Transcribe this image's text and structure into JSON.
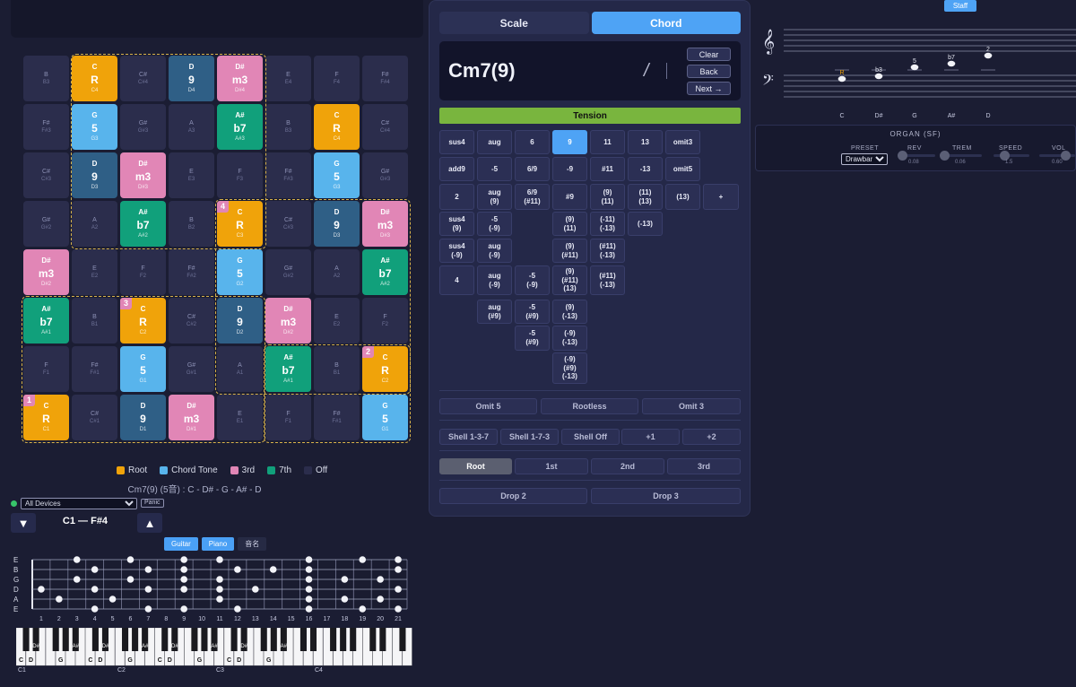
{
  "pads": [
    [
      {
        "n": "B",
        "o": "B3"
      },
      {
        "n": "C",
        "o": "C4",
        "i": "R",
        "t": "root"
      },
      {
        "n": "C#",
        "o": "C#4"
      },
      {
        "n": "D",
        "o": "D4",
        "i": "9",
        "t": "tone-9"
      },
      {
        "n": "D#",
        "o": "D#4",
        "i": "m3",
        "t": "third"
      },
      {
        "n": "E",
        "o": "E4"
      },
      {
        "n": "F",
        "o": "F4"
      },
      {
        "n": "F#",
        "o": "F#4"
      }
    ],
    [
      {
        "n": "F#",
        "o": "F#3"
      },
      {
        "n": "G",
        "o": "G3",
        "i": "5",
        "t": "tone-5"
      },
      {
        "n": "G#",
        "o": "G#3"
      },
      {
        "n": "A",
        "o": "A3"
      },
      {
        "n": "A#",
        "o": "A#3",
        "i": "b7",
        "t": "seventh"
      },
      {
        "n": "B",
        "o": "B3"
      },
      {
        "n": "C",
        "o": "C4",
        "i": "R",
        "t": "root"
      },
      {
        "n": "C#",
        "o": "C#4"
      }
    ],
    [
      {
        "n": "C#",
        "o": "C#3"
      },
      {
        "n": "D",
        "o": "D3",
        "i": "9",
        "t": "tone-9"
      },
      {
        "n": "D#",
        "o": "D#3",
        "i": "m3",
        "t": "third"
      },
      {
        "n": "E",
        "o": "E3"
      },
      {
        "n": "F",
        "o": "F3"
      },
      {
        "n": "F#",
        "o": "F#3"
      },
      {
        "n": "G",
        "o": "G3",
        "i": "5",
        "t": "tone-5"
      },
      {
        "n": "G#",
        "o": "G#3"
      }
    ],
    [
      {
        "n": "G#",
        "o": "G#2"
      },
      {
        "n": "A",
        "o": "A2"
      },
      {
        "n": "A#",
        "o": "A#2",
        "i": "b7",
        "t": "seventh"
      },
      {
        "n": "B",
        "o": "B2"
      },
      {
        "n": "C",
        "o": "C3",
        "i": "R",
        "t": "root",
        "b": "4"
      },
      {
        "n": "C#",
        "o": "C#3"
      },
      {
        "n": "D",
        "o": "D3",
        "i": "9",
        "t": "tone-9"
      },
      {
        "n": "D#",
        "o": "D#3",
        "i": "m3",
        "t": "third"
      }
    ],
    [
      {
        "n": "D#",
        "o": "D#2",
        "i": "m3",
        "t": "third"
      },
      {
        "n": "E",
        "o": "E2"
      },
      {
        "n": "F",
        "o": "F2"
      },
      {
        "n": "F#",
        "o": "F#2"
      },
      {
        "n": "G",
        "o": "G2",
        "i": "5",
        "t": "tone-5"
      },
      {
        "n": "G#",
        "o": "G#2"
      },
      {
        "n": "A",
        "o": "A2"
      },
      {
        "n": "A#",
        "o": "A#2",
        "i": "b7",
        "t": "seventh"
      }
    ],
    [
      {
        "n": "A#",
        "o": "A#1",
        "i": "b7",
        "t": "seventh"
      },
      {
        "n": "B",
        "o": "B1"
      },
      {
        "n": "C",
        "o": "C2",
        "i": "R",
        "t": "root",
        "b": "3"
      },
      {
        "n": "C#",
        "o": "C#2"
      },
      {
        "n": "D",
        "o": "D2",
        "i": "9",
        "t": "tone-9"
      },
      {
        "n": "D#",
        "o": "D#2",
        "i": "m3",
        "t": "third"
      },
      {
        "n": "E",
        "o": "E2"
      },
      {
        "n": "F",
        "o": "F2"
      }
    ],
    [
      {
        "n": "F",
        "o": "F1"
      },
      {
        "n": "F#",
        "o": "F#1"
      },
      {
        "n": "G",
        "o": "G1",
        "i": "5",
        "t": "tone-5"
      },
      {
        "n": "G#",
        "o": "G#1"
      },
      {
        "n": "A",
        "o": "A1"
      },
      {
        "n": "A#",
        "o": "A#1",
        "i": "b7",
        "t": "seventh"
      },
      {
        "n": "B",
        "o": "B1"
      },
      {
        "n": "C",
        "o": "C2",
        "i": "R",
        "t": "root",
        "b": "2"
      }
    ],
    [
      {
        "n": "C",
        "o": "C1",
        "i": "R",
        "t": "root",
        "b": "1"
      },
      {
        "n": "C#",
        "o": "C#1"
      },
      {
        "n": "D",
        "o": "D1",
        "i": "9",
        "t": "tone-9"
      },
      {
        "n": "D#",
        "o": "D#1",
        "i": "m3",
        "t": "third"
      },
      {
        "n": "E",
        "o": "E1"
      },
      {
        "n": "F",
        "o": "F1"
      },
      {
        "n": "F#",
        "o": "F#1"
      },
      {
        "n": "G",
        "o": "G1",
        "i": "5",
        "t": "tone-5"
      }
    ]
  ],
  "legend": [
    {
      "label": "Root",
      "color": "#f0a30a"
    },
    {
      "label": "Chord Tone",
      "color": "#58b4ec"
    },
    {
      "label": "3rd",
      "color": "#e186b6"
    },
    {
      "label": "7th",
      "color": "#11a07b"
    },
    {
      "label": "Off",
      "color": "#2b2d4c"
    }
  ],
  "chord_formula": "Cm7(9) (5音) : C - D# - G - A# - D",
  "device": {
    "selected": "All Devices",
    "panic": "Panic"
  },
  "octave": {
    "down": "▼",
    "up": "▲",
    "range": "C1 — F#4"
  },
  "instrument_tabs": [
    "Guitar",
    "Piano",
    "音名"
  ],
  "fretboard": {
    "strings": [
      "E",
      "B",
      "G",
      "D",
      "A",
      "E"
    ],
    "frets": [
      "1",
      "2",
      "3",
      "4",
      "5",
      "6",
      "7",
      "8",
      "9",
      "10",
      "11",
      "12",
      "13",
      "14",
      "15",
      "16",
      "17",
      "18",
      "19",
      "20",
      "21"
    ]
  },
  "piano": {
    "octave_labels": [
      "C1",
      "C2",
      "C3",
      "C4"
    ],
    "key_labels": [
      "C",
      "D",
      "D#",
      "G",
      "A#"
    ]
  },
  "mode_tabs": [
    "Scale",
    "Chord"
  ],
  "display": {
    "chord": "Cm7(9)",
    "slash": "/",
    "clear": "Clear",
    "back": "Back",
    "next": "Next →"
  },
  "tension_label": "Tension",
  "tension_buttons": [
    [
      "sus4",
      "aug",
      "6",
      "9",
      "11",
      "13",
      "omit3"
    ],
    [
      "add9",
      "-5",
      "6/9",
      "-9",
      "#11",
      "-13",
      "omit5"
    ],
    [
      "2",
      "aug\n(9)",
      "6/9\n(#11)",
      "#9",
      "(9)\n(11)",
      "(11)\n(13)",
      "(13)",
      "+"
    ],
    [
      "sus4\n(9)",
      "-5\n(-9)",
      "",
      "(9)\n(11)",
      "(-11)\n(-13)",
      "(-13)"
    ],
    [
      "sus4\n(-9)",
      "aug\n(-9)",
      "",
      "(9)\n(#11)",
      "(#11)\n(-13)"
    ],
    [
      "4",
      "aug\n(-9)",
      "-5\n(-9)",
      "(9)\n(#11)\n(13)",
      "(#11)\n(-13)"
    ],
    [
      "",
      "aug\n(#9)",
      "-5\n(#9)",
      "(9)\n(-13)"
    ],
    [
      "",
      "",
      "-5\n(#9)",
      "(-9)\n(-13)"
    ],
    [
      "",
      "",
      "",
      "(-9)\n(#9)\n(-13)"
    ]
  ],
  "omit_buttons": [
    "Omit 5",
    "Rootless",
    "Omit 3"
  ],
  "shell_buttons": [
    "Shell 1-3-7",
    "Shell 1-7-3",
    "Shell Off",
    "+1",
    "+2"
  ],
  "inversion_buttons": [
    "Root",
    "1st",
    "2nd",
    "3rd"
  ],
  "drop_buttons": [
    "Drop 2",
    "Drop 3"
  ],
  "staff": {
    "toggle": "Staff",
    "note_names": [
      "C",
      "D#",
      "G",
      "A#",
      "D"
    ],
    "intervals": [
      "R",
      "b3",
      "5",
      "b7",
      "2"
    ]
  },
  "organ": {
    "title": "ORGAN (SF)",
    "preset_label": "PRESET",
    "preset": "Drawbar",
    "rev_label": "REV",
    "rev": "0.08",
    "trem_label": "TREM",
    "trem": "0.06",
    "speed_label": "SPEED",
    "speed": "1.5",
    "vol_label": "VOL",
    "vol": "0.60"
  }
}
